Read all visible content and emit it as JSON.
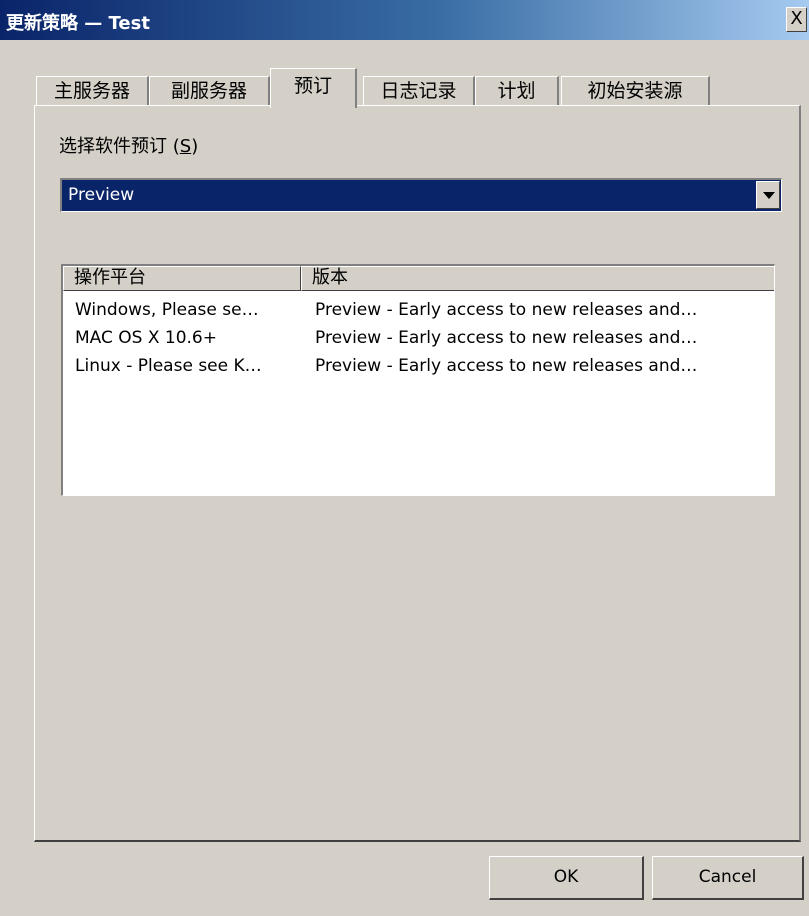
{
  "window": {
    "title": "更新策略 — Test",
    "close_label": "X"
  },
  "tabs": [
    {
      "label": "主服务器",
      "active": false
    },
    {
      "label": "副服务器",
      "active": false
    },
    {
      "label": "预订",
      "active": true
    },
    {
      "label": "日志记录",
      "active": false
    },
    {
      "label": "计划",
      "active": false
    },
    {
      "label": "初始安装源",
      "active": false
    }
  ],
  "subscription": {
    "label": "选择软件预订",
    "accelerator_open": "(",
    "accelerator_key": "S",
    "accelerator_close": ")",
    "selected_value": "Preview"
  },
  "list": {
    "columns": [
      "操作平台",
      "版本"
    ],
    "rows": [
      {
        "platform": "Windows, Please se…",
        "version": "Preview - Early access to new releases and…"
      },
      {
        "platform": "MAC OS X 10.6+",
        "version": "Preview - Early access to new releases and…"
      },
      {
        "platform": "Linux - Please see K…",
        "version": "Preview - Early access to new releases and…"
      }
    ]
  },
  "buttons": {
    "ok": "OK",
    "cancel": "Cancel"
  }
}
